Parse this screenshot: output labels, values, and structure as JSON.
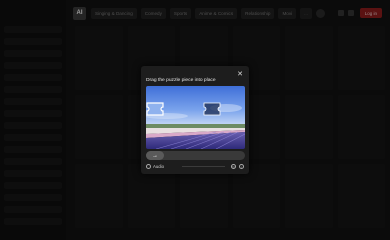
{
  "topbar": {
    "logo": "AI",
    "categories": [
      "Singing & Dancing",
      "Comedy",
      "Sports",
      "Anime & Comics",
      "Relationship",
      "Movi"
    ],
    "more": "...",
    "login_label": "Log in"
  },
  "captcha": {
    "title": "Drag the puzzle piece into place",
    "close_glyph": "✕",
    "slider_glyph": "→",
    "audio_label": "Audio",
    "refresh_glyph": "↻",
    "info_glyph": "i"
  },
  "colors": {
    "accent_red": "#8a1c1c",
    "dialog_bg": "#1d1d1d"
  }
}
